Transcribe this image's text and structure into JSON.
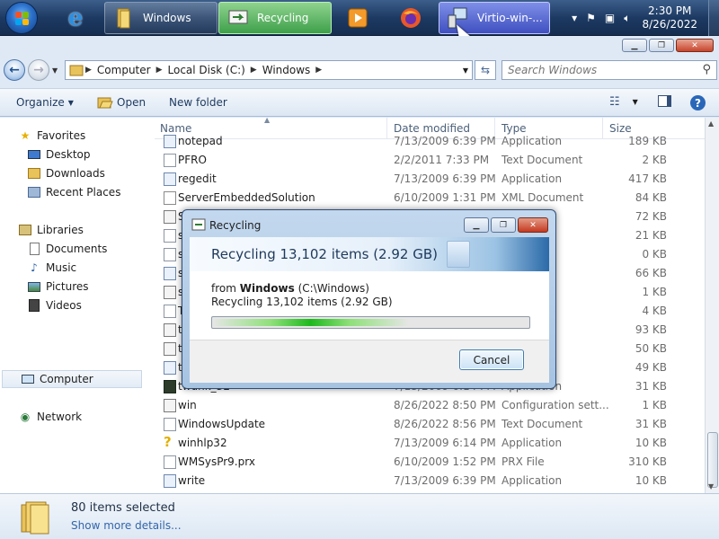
{
  "taskbar": {
    "buttons": [
      {
        "label": "Windows"
      },
      {
        "label": "Recycling"
      },
      {
        "label": "Virtio-win-..."
      }
    ],
    "clock": {
      "time": "2:30 PM",
      "date": "8/26/2022"
    }
  },
  "address": {
    "crumbs": [
      "Computer",
      "Local Disk (C:)",
      "Windows"
    ]
  },
  "search": {
    "placeholder": "Search Windows"
  },
  "toolbar": {
    "organize": "Organize",
    "open": "Open",
    "new_folder": "New folder"
  },
  "nav": {
    "favorites": "Favorites",
    "desktop": "Desktop",
    "downloads": "Downloads",
    "recent": "Recent Places",
    "libraries": "Libraries",
    "documents": "Documents",
    "music": "Music",
    "pictures": "Pictures",
    "videos": "Videos",
    "computer": "Computer",
    "network": "Network"
  },
  "columns": {
    "name": "Name",
    "date": "Date modified",
    "type": "Type",
    "size": "Size"
  },
  "files": [
    {
      "name": "notepad",
      "date": "7/13/2009 6:39 PM",
      "type": "Application",
      "size": "189 KB",
      "icon": "app"
    },
    {
      "name": "PFRO",
      "date": "2/2/2011 7:33 PM",
      "type": "Text Document",
      "size": "2 KB",
      "icon": "doc"
    },
    {
      "name": "regedit",
      "date": "7/13/2009 6:39 PM",
      "type": "Application",
      "size": "417 KB",
      "icon": "app"
    },
    {
      "name": "ServerEmbeddedSolution",
      "date": "6/10/2009 1:31 PM",
      "type": "XML Document",
      "size": "84 KB",
      "icon": "xml"
    },
    {
      "name": "S",
      "date": "",
      "type": "ment",
      "size": "72 KB",
      "icon": "cfg"
    },
    {
      "name": "s",
      "date": "",
      "type": "ment",
      "size": "21 KB",
      "icon": "doc"
    },
    {
      "name": "s",
      "date": "",
      "type": "ment",
      "size": "0 KB",
      "icon": "doc"
    },
    {
      "name": "s",
      "date": "",
      "type": "",
      "size": "66 KB",
      "icon": "app"
    },
    {
      "name": "s",
      "date": "",
      "type": "on sett...",
      "size": "1 KB",
      "icon": "cfg"
    },
    {
      "name": "T",
      "date": "",
      "type": "ment",
      "size": "4 KB",
      "icon": "doc"
    },
    {
      "name": "t",
      "date": "",
      "type": "extens...",
      "size": "93 KB",
      "icon": "cfg"
    },
    {
      "name": "t",
      "date": "",
      "type": "extens...",
      "size": "50 KB",
      "icon": "cfg"
    },
    {
      "name": "t",
      "date": "",
      "type": "",
      "size": "49 KB",
      "icon": "app"
    },
    {
      "name": "twunk_32",
      "date": "7/13/2009 6:14 PM",
      "type": "Application",
      "size": "31 KB",
      "icon": "dark"
    },
    {
      "name": "win",
      "date": "8/26/2022 8:50 PM",
      "type": "Configuration sett...",
      "size": "1 KB",
      "icon": "cfg"
    },
    {
      "name": "WindowsUpdate",
      "date": "8/26/2022 8:56 PM",
      "type": "Text Document",
      "size": "31 KB",
      "icon": "doc"
    },
    {
      "name": "winhlp32",
      "date": "7/13/2009 6:14 PM",
      "type": "Application",
      "size": "10 KB",
      "icon": "help"
    },
    {
      "name": "WMSysPr9.prx",
      "date": "6/10/2009 1:52 PM",
      "type": "PRX File",
      "size": "310 KB",
      "icon": "doc"
    },
    {
      "name": "write",
      "date": "7/13/2009 6:39 PM",
      "type": "Application",
      "size": "10 KB",
      "icon": "app"
    }
  ],
  "details": {
    "count": "80 items selected",
    "more": "Show more details..."
  },
  "dialog": {
    "title": "Recycling",
    "header": "Recycling 13,102 items (2.92 GB)",
    "from_prefix": "from",
    "from_name": "Windows",
    "from_path": "(C:\\Windows)",
    "progress_text": "Recycling 13,102 items (2.92 GB)",
    "progress_fraction": 0.62,
    "cancel": "Cancel"
  }
}
